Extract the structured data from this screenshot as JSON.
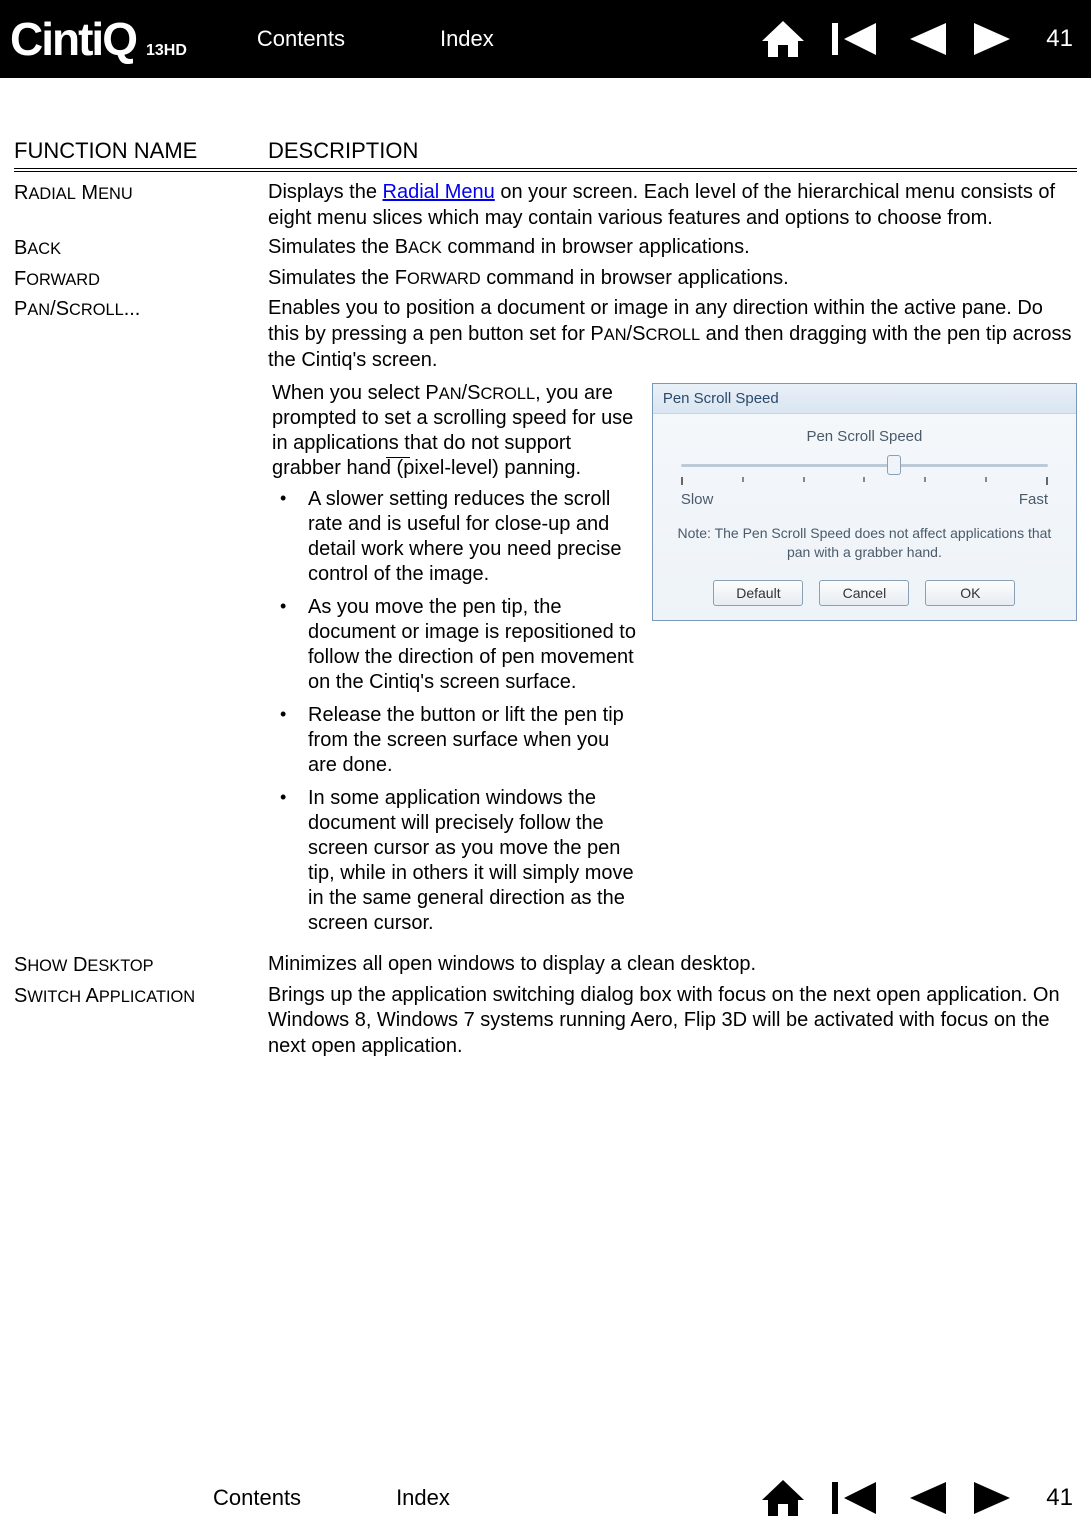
{
  "logo": {
    "main": "CintiQ",
    "sub": "13HD"
  },
  "nav": {
    "contents": "Contents",
    "index": "Index"
  },
  "page_number": "41",
  "headers": {
    "fn": "FUNCTION NAME",
    "desc": "DESCRIPTION"
  },
  "rows": {
    "radial": {
      "name_first": "R",
      "name_rest_1": "adial",
      "name_first_2": "M",
      "name_rest_2": "enu",
      "desc_pre": "Displays the ",
      "link": "Radial Menu",
      "desc_post": " on your screen. Each level of the hierarchical menu consists of eight menu slices which may contain various features and options to choose from."
    },
    "back": {
      "name_first": "B",
      "name_rest_1": "ack",
      "desc_pre": "Simulates the ",
      "sc_first": "B",
      "sc_rest": "ack",
      "desc_post": " command in browser applications."
    },
    "forward": {
      "name_first": "F",
      "name_rest_1": "orward",
      "desc_pre": "Simulates the ",
      "sc_first": "F",
      "sc_rest": "orward",
      "desc_post": " command in browser applications."
    },
    "panscroll": {
      "name_first": "P",
      "name_rest_1": "an",
      "slash": "/",
      "name_first_2": "S",
      "name_rest_2": "croll",
      "dots": "...",
      "desc_pre": "Enables you to position a document or image in any direction within the active pane. Do this by pressing a pen button set for ",
      "sc_first_1": "P",
      "sc_rest_1": "an",
      "sc_slash": "/",
      "sc_first_2": "S",
      "sc_rest_2": "croll",
      "desc_post": " and then dragging with the pen tip across the Cintiq's screen."
    },
    "showdesktop": {
      "name_first": "S",
      "name_rest_1": "how",
      "name_first_2": "D",
      "name_rest_2": "esktop",
      "desc": "Minimizes all open windows to display a clean desktop."
    },
    "switchapp": {
      "name_first": "S",
      "name_rest_1": "witch",
      "name_first_2": "A",
      "name_rest_2": "pplication",
      "desc": "Brings up the application switching dialog box with focus on the next open application. On Windows 8, Windows 7 systems running Aero, Flip 3D will be activated with focus on the next open application."
    }
  },
  "pan_details": {
    "intro_pre": "When you select ",
    "sc_first_1": "P",
    "sc_rest_1": "an",
    "sc_slash": "/",
    "sc_first_2": "S",
    "sc_rest_2": "croll",
    "intro_post": ", you are prompted to set a scrolling speed for use in applications that do not support grabber hand (pixel-level) panning.",
    "bullets": [
      "A slower setting reduces the scroll rate and is useful for close-up and detail work where you need precise control of the image.",
      "As you move the pen tip, the document or image is repositioned to follow the direction of pen movement on the Cintiq's screen surface.",
      "Release the button or lift the pen tip from the screen surface when you are done.",
      "In some application windows the document will precisely follow the screen cursor as you move the pen tip, while in others it will simply move in the same general direction as the screen cursor."
    ]
  },
  "dialog": {
    "title": "Pen Scroll Speed",
    "label": "Pen Scroll Speed",
    "slow": "Slow",
    "fast": "Fast",
    "note": "Note: The Pen Scroll Speed does not affect applications that pan with a grabber hand.",
    "btn_default": "Default",
    "btn_cancel": "Cancel",
    "btn_ok": "OK"
  }
}
